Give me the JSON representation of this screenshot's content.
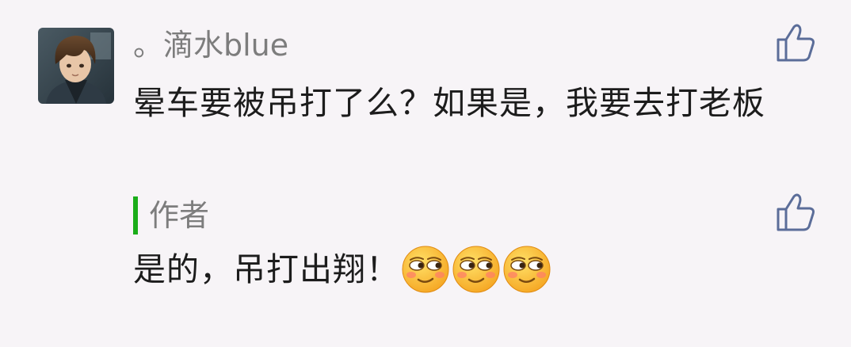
{
  "comment": {
    "username": "。滴水blue",
    "text": "晕车要被吊打了么？如果是，我要去打老板",
    "avatar_icon": "avatar-icon"
  },
  "reply": {
    "author_label": "作者",
    "text": "是的，吊打出翔！",
    "emojis": [
      "smirk-emoji",
      "smirk-emoji",
      "smirk-emoji"
    ]
  },
  "icons": {
    "like": "thumbs-up-icon"
  },
  "colors": {
    "background": "#f7f4f7",
    "author_bar": "#1aad19",
    "like_icon": "#5b6d99",
    "username": "#7d7d7d"
  }
}
